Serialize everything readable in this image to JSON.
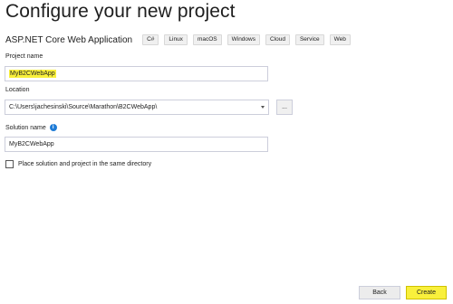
{
  "header": {
    "title": "Configure your new project"
  },
  "template": {
    "name": "ASP.NET Core Web Application",
    "tags": [
      "C#",
      "Linux",
      "macOS",
      "Windows",
      "Cloud",
      "Service",
      "Web"
    ]
  },
  "project_name": {
    "label": "Project name",
    "value": "MyB2CWebApp"
  },
  "location": {
    "label": "Location",
    "value": "C:\\Users\\jachesinski\\Source\\Marathon\\B2CWebApp\\",
    "browse_label": "..."
  },
  "solution_name": {
    "label": "Solution name",
    "value": "MyB2CWebApp",
    "info_glyph": "i"
  },
  "options": {
    "same_directory_label": "Place solution and project in the same directory",
    "same_directory_checked": false
  },
  "footer": {
    "back_label": "Back",
    "create_label": "Create"
  },
  "colors": {
    "highlight": "#f9f03c",
    "info_icon": "#1e7bd6"
  }
}
